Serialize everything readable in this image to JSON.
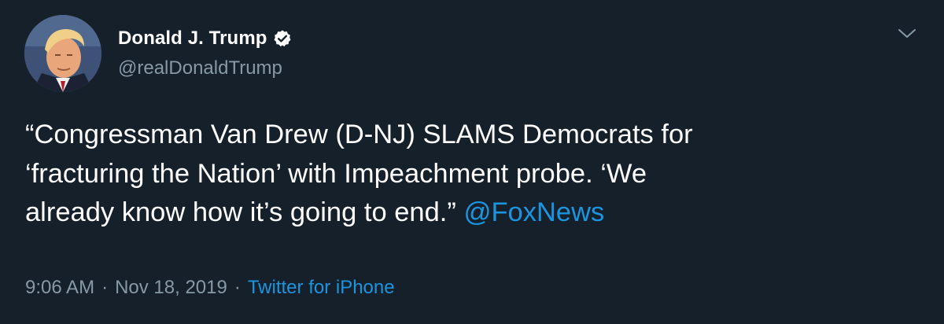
{
  "author": {
    "display_name": "Donald J. Trump",
    "handle": "@realDonaldTrump",
    "verified": true
  },
  "tweet": {
    "lines": [
      "“Congressman Van Drew (D-NJ) SLAMS Democrats for",
      "‘fracturing the Nation’ with Impeachment probe. ‘We",
      "already know how it’s going to end.”"
    ],
    "mention": "@FoxNews"
  },
  "meta": {
    "time": "9:06 AM",
    "date": "Nov 18, 2019",
    "separator": "·",
    "source": "Twitter for iPhone"
  },
  "icons": {
    "verified": "verified-badge-icon",
    "menu": "chevron-down-icon"
  },
  "colors": {
    "background": "#15202b",
    "text": "#ffffff",
    "secondary": "#8899a6",
    "link": "#1b95e0"
  }
}
